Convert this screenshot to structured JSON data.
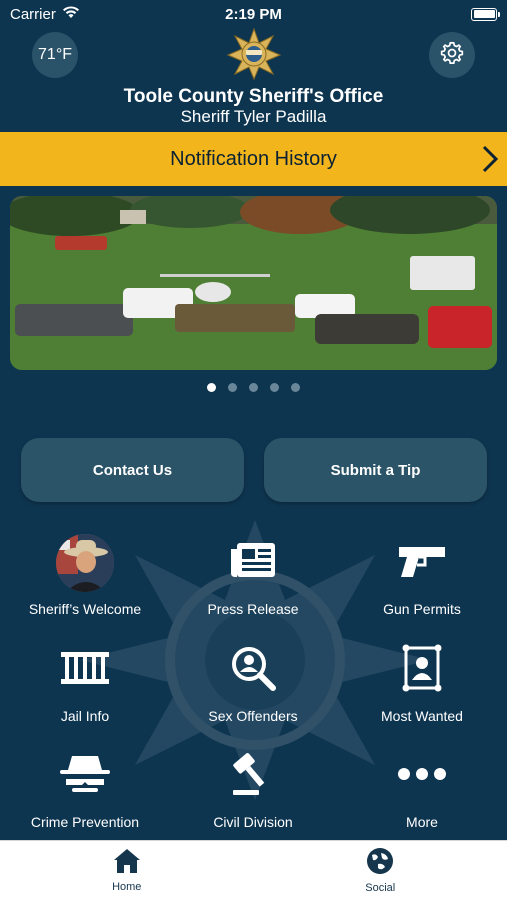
{
  "status_bar": {
    "carrier": "Carrier",
    "time": "2:19 PM"
  },
  "header": {
    "temperature": "71°F",
    "title": "Toole County Sheriff's Office",
    "subtitle": "Sheriff Tyler Padilla"
  },
  "notification": {
    "label": "Notification History"
  },
  "carousel": {
    "page_count": 5,
    "active_index": 0
  },
  "actions": {
    "contact": "Contact Us",
    "tip": "Submit a Tip"
  },
  "grid": [
    {
      "label": "Sheriff’s Welcome",
      "icon": "sheriff-avatar"
    },
    {
      "label": "Press Release",
      "icon": "newspaper-icon"
    },
    {
      "label": "Gun Permits",
      "icon": "gun-icon"
    },
    {
      "label": "Jail Info",
      "icon": "jail-icon"
    },
    {
      "label": "Sex Offenders",
      "icon": "search-person-icon"
    },
    {
      "label": "Most Wanted",
      "icon": "wanted-poster-icon"
    },
    {
      "label": "Crime Prevention",
      "icon": "incognito-icon"
    },
    {
      "label": "Civil Division",
      "icon": "gavel-icon"
    },
    {
      "label": "More",
      "icon": "more-icon"
    }
  ],
  "tabbar": {
    "home": "Home",
    "social": "Social"
  },
  "colors": {
    "background": "#0e3550",
    "accent": "#f2b51c",
    "button": "#2c5468",
    "tab_active": "#16364d"
  }
}
